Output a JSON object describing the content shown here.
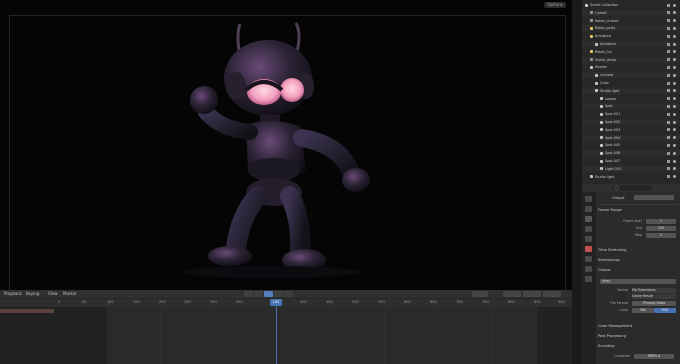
{
  "viewport": {
    "options_label": "Options"
  },
  "timeline": {
    "menus": [
      "Playback",
      "Keying",
      "View",
      "Marker"
    ],
    "current_frame": "100",
    "ticks": [
      "0",
      "50",
      "100",
      "150",
      "200",
      "250",
      "300",
      "350",
      "400",
      "450",
      "500",
      "550",
      "600",
      "650",
      "700",
      "750",
      "800",
      "850",
      "900"
    ]
  },
  "outliner": {
    "rows": [
      {
        "label": "Scene Collection",
        "indent": 0,
        "color": "#d0d0d0"
      },
      {
        "label": "Lineart",
        "indent": 1,
        "color": "#9a9a9a"
      },
      {
        "label": "Robot_Lineart",
        "indent": 1,
        "color": "#9a9a9a"
      },
      {
        "label": "Robot_parts",
        "indent": 1,
        "color": "#e6c36a"
      },
      {
        "label": "Armature",
        "indent": 1,
        "color": "#e6c36a"
      },
      {
        "label": "Armature",
        "indent": 2,
        "color": "#c8c8c8"
      },
      {
        "label": "Robot_full",
        "indent": 1,
        "color": "#e6c36a"
      },
      {
        "label": "Scene_dress",
        "indent": 1,
        "color": "#9a9a9a"
      },
      {
        "label": "Shader",
        "indent": 1,
        "color": "#c8c8c8"
      },
      {
        "label": "Camera",
        "indent": 2,
        "color": "#c8c8c8"
      },
      {
        "label": "Cube",
        "indent": 2,
        "color": "#c8c8c8"
      },
      {
        "label": "Studio light",
        "indent": 2,
        "color": "#c8c8c8"
      },
      {
        "label": "Lamps",
        "indent": 3,
        "color": "#c8c8c8"
      },
      {
        "label": "Spot",
        "indent": 3,
        "color": "#c8c8c8"
      },
      {
        "label": "Spot.001",
        "indent": 3,
        "color": "#c8c8c8"
      },
      {
        "label": "Spot.002",
        "indent": 3,
        "color": "#c8c8c8"
      },
      {
        "label": "Spot.003",
        "indent": 3,
        "color": "#c8c8c8"
      },
      {
        "label": "Spot.004",
        "indent": 3,
        "color": "#c8c8c8"
      },
      {
        "label": "Spot.005",
        "indent": 3,
        "color": "#c8c8c8"
      },
      {
        "label": "Spot.006",
        "indent": 3,
        "color": "#c8c8c8"
      },
      {
        "label": "Spot.007",
        "indent": 3,
        "color": "#c8c8c8"
      },
      {
        "label": "Light.003",
        "indent": 3,
        "color": "#c8c8c8"
      },
      {
        "label": "Studio light",
        "indent": 1,
        "color": "#c8c8c8"
      }
    ]
  },
  "properties": {
    "output_label": "Output",
    "sections": {
      "frame_range": "Frame Range",
      "time_stretching": "Time Stretching",
      "stereoscopy": "Stereoscopy",
      "output": "Output",
      "color_management": "Color Management",
      "post_processing": "Post Processing",
      "encoding": "Encoding"
    },
    "frame_start_label": "Frame Start",
    "frame_start": "1",
    "end_label": "End",
    "end": "250",
    "step_label": "Step",
    "step": "1",
    "output_path": "/tmp/",
    "saving_label": "Saving",
    "file_extensions": "File Extensions",
    "cache_result": "Cache Result",
    "file_format_label": "File Format",
    "file_format": "FFmpeg Video",
    "color_label": "Color",
    "color_bw": "BW",
    "color_rgb": "RGB",
    "container_label": "Container",
    "container": "MPEG-4"
  }
}
